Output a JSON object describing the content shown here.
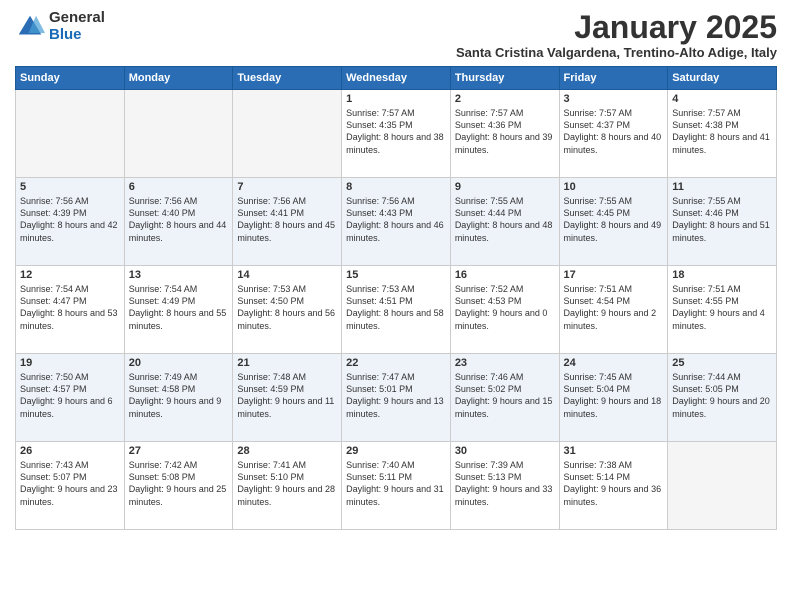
{
  "logo": {
    "general": "General",
    "blue": "Blue"
  },
  "title": "January 2025",
  "subtitle": "Santa Cristina Valgardena, Trentino-Alto Adige, Italy",
  "days_of_week": [
    "Sunday",
    "Monday",
    "Tuesday",
    "Wednesday",
    "Thursday",
    "Friday",
    "Saturday"
  ],
  "weeks": [
    [
      {
        "day": "",
        "info": ""
      },
      {
        "day": "",
        "info": ""
      },
      {
        "day": "",
        "info": ""
      },
      {
        "day": "1",
        "info": "Sunrise: 7:57 AM\nSunset: 4:35 PM\nDaylight: 8 hours and 38 minutes."
      },
      {
        "day": "2",
        "info": "Sunrise: 7:57 AM\nSunset: 4:36 PM\nDaylight: 8 hours and 39 minutes."
      },
      {
        "day": "3",
        "info": "Sunrise: 7:57 AM\nSunset: 4:37 PM\nDaylight: 8 hours and 40 minutes."
      },
      {
        "day": "4",
        "info": "Sunrise: 7:57 AM\nSunset: 4:38 PM\nDaylight: 8 hours and 41 minutes."
      }
    ],
    [
      {
        "day": "5",
        "info": "Sunrise: 7:56 AM\nSunset: 4:39 PM\nDaylight: 8 hours and 42 minutes."
      },
      {
        "day": "6",
        "info": "Sunrise: 7:56 AM\nSunset: 4:40 PM\nDaylight: 8 hours and 44 minutes."
      },
      {
        "day": "7",
        "info": "Sunrise: 7:56 AM\nSunset: 4:41 PM\nDaylight: 8 hours and 45 minutes."
      },
      {
        "day": "8",
        "info": "Sunrise: 7:56 AM\nSunset: 4:43 PM\nDaylight: 8 hours and 46 minutes."
      },
      {
        "day": "9",
        "info": "Sunrise: 7:55 AM\nSunset: 4:44 PM\nDaylight: 8 hours and 48 minutes."
      },
      {
        "day": "10",
        "info": "Sunrise: 7:55 AM\nSunset: 4:45 PM\nDaylight: 8 hours and 49 minutes."
      },
      {
        "day": "11",
        "info": "Sunrise: 7:55 AM\nSunset: 4:46 PM\nDaylight: 8 hours and 51 minutes."
      }
    ],
    [
      {
        "day": "12",
        "info": "Sunrise: 7:54 AM\nSunset: 4:47 PM\nDaylight: 8 hours and 53 minutes."
      },
      {
        "day": "13",
        "info": "Sunrise: 7:54 AM\nSunset: 4:49 PM\nDaylight: 8 hours and 55 minutes."
      },
      {
        "day": "14",
        "info": "Sunrise: 7:53 AM\nSunset: 4:50 PM\nDaylight: 8 hours and 56 minutes."
      },
      {
        "day": "15",
        "info": "Sunrise: 7:53 AM\nSunset: 4:51 PM\nDaylight: 8 hours and 58 minutes."
      },
      {
        "day": "16",
        "info": "Sunrise: 7:52 AM\nSunset: 4:53 PM\nDaylight: 9 hours and 0 minutes."
      },
      {
        "day": "17",
        "info": "Sunrise: 7:51 AM\nSunset: 4:54 PM\nDaylight: 9 hours and 2 minutes."
      },
      {
        "day": "18",
        "info": "Sunrise: 7:51 AM\nSunset: 4:55 PM\nDaylight: 9 hours and 4 minutes."
      }
    ],
    [
      {
        "day": "19",
        "info": "Sunrise: 7:50 AM\nSunset: 4:57 PM\nDaylight: 9 hours and 6 minutes."
      },
      {
        "day": "20",
        "info": "Sunrise: 7:49 AM\nSunset: 4:58 PM\nDaylight: 9 hours and 9 minutes."
      },
      {
        "day": "21",
        "info": "Sunrise: 7:48 AM\nSunset: 4:59 PM\nDaylight: 9 hours and 11 minutes."
      },
      {
        "day": "22",
        "info": "Sunrise: 7:47 AM\nSunset: 5:01 PM\nDaylight: 9 hours and 13 minutes."
      },
      {
        "day": "23",
        "info": "Sunrise: 7:46 AM\nSunset: 5:02 PM\nDaylight: 9 hours and 15 minutes."
      },
      {
        "day": "24",
        "info": "Sunrise: 7:45 AM\nSunset: 5:04 PM\nDaylight: 9 hours and 18 minutes."
      },
      {
        "day": "25",
        "info": "Sunrise: 7:44 AM\nSunset: 5:05 PM\nDaylight: 9 hours and 20 minutes."
      }
    ],
    [
      {
        "day": "26",
        "info": "Sunrise: 7:43 AM\nSunset: 5:07 PM\nDaylight: 9 hours and 23 minutes."
      },
      {
        "day": "27",
        "info": "Sunrise: 7:42 AM\nSunset: 5:08 PM\nDaylight: 9 hours and 25 minutes."
      },
      {
        "day": "28",
        "info": "Sunrise: 7:41 AM\nSunset: 5:10 PM\nDaylight: 9 hours and 28 minutes."
      },
      {
        "day": "29",
        "info": "Sunrise: 7:40 AM\nSunset: 5:11 PM\nDaylight: 9 hours and 31 minutes."
      },
      {
        "day": "30",
        "info": "Sunrise: 7:39 AM\nSunset: 5:13 PM\nDaylight: 9 hours and 33 minutes."
      },
      {
        "day": "31",
        "info": "Sunrise: 7:38 AM\nSunset: 5:14 PM\nDaylight: 9 hours and 36 minutes."
      },
      {
        "day": "",
        "info": ""
      }
    ]
  ]
}
